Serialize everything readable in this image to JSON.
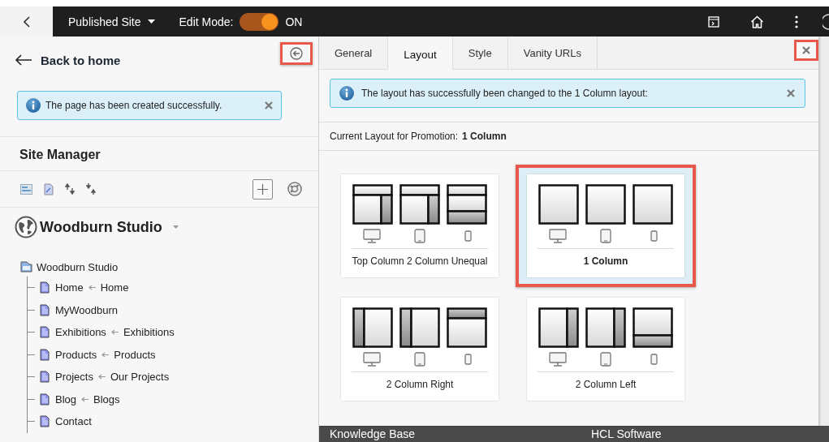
{
  "top_bar": {
    "site_menu": "Published Site",
    "edit_mode": {
      "label": "Edit Mode:",
      "on": true,
      "state_text": "ON"
    }
  },
  "left_panel": {
    "back_link": "Back to home",
    "alert": "The page has been created successfully.",
    "title": "Site Manager",
    "site_name": "Woodburn Studio",
    "tree": [
      {
        "label": "Woodburn Studio",
        "children": [
          {
            "label": "Home",
            "target": "Home"
          },
          {
            "label": "MyWoodburn"
          },
          {
            "label": "Exhibitions",
            "target": "Exhibitions"
          },
          {
            "label": "Products",
            "target": "Products"
          },
          {
            "label": "Projects",
            "target": "Our Projects"
          },
          {
            "label": "Blog",
            "target": "Blogs"
          },
          {
            "label": "Contact"
          }
        ]
      }
    ]
  },
  "dialog": {
    "tabs": [
      {
        "label": "General",
        "selected": false
      },
      {
        "label": "Layout",
        "selected": true
      },
      {
        "label": "Style",
        "selected": false
      },
      {
        "label": "Vanity URLs",
        "selected": false
      }
    ],
    "alert": "The layout has successfully been changed to the 1 Column layout:",
    "current_layout": {
      "label": "Current Layout for Promotion:",
      "value": "1 Column"
    },
    "layouts": [
      {
        "name": "Top Column 2 Column Unequal",
        "kind": "top-split",
        "selected": false
      },
      {
        "name": "1 Column",
        "kind": "one-column",
        "selected": true
      },
      {
        "name": "2 Column Right",
        "kind": "two-right",
        "selected": false
      },
      {
        "name": "2 Column Left",
        "kind": "two-left",
        "selected": false
      }
    ]
  },
  "footer": {
    "links": [
      "Knowledge Base",
      "HCL Software"
    ]
  }
}
